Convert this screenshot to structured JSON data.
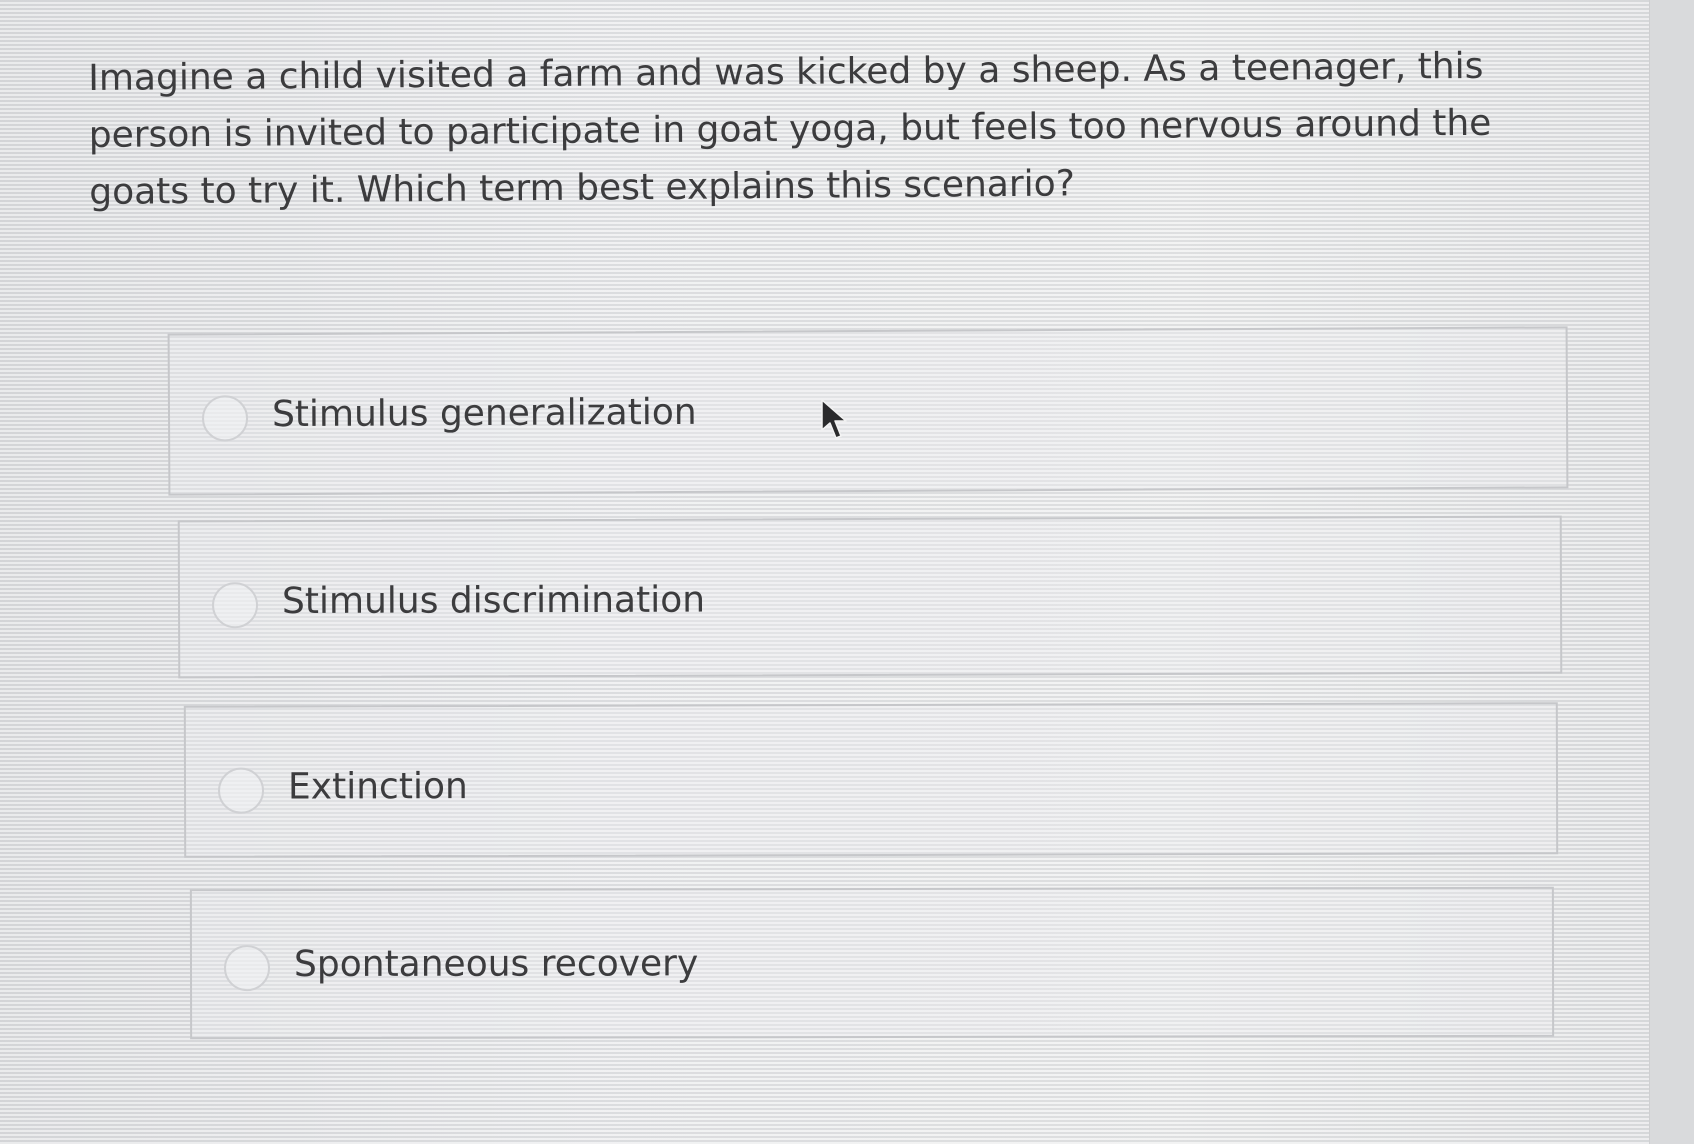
{
  "question": {
    "text": "Imagine a child visited a farm and was kicked by a sheep. As a teenager, this person is invited to participate in goat yoga, but feels too nervous around the goats to try it. Which term best explains this scenario?"
  },
  "options": [
    {
      "label": "Stimulus generalization"
    },
    {
      "label": "Stimulus discrimination"
    },
    {
      "label": "Extinction"
    },
    {
      "label": "Spontaneous recovery"
    }
  ],
  "cursor": {
    "icon": "arrow-cursor-icon"
  }
}
